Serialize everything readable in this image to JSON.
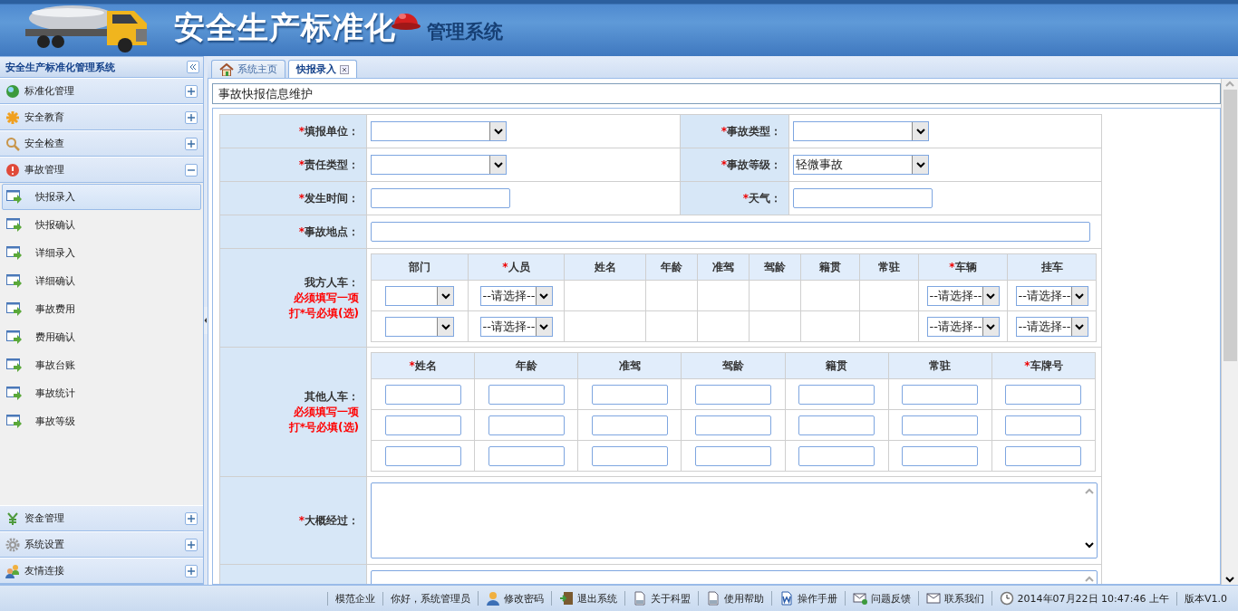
{
  "header": {
    "title": "安全生产标准化",
    "subtitle": "管理系统"
  },
  "sidebar": {
    "title": "安全生产标准化管理系统",
    "sections": [
      {
        "label": "标准化管理",
        "expanded": false
      },
      {
        "label": "安全教育",
        "expanded": false
      },
      {
        "label": "安全检查",
        "expanded": false
      },
      {
        "label": "事故管理",
        "expanded": true,
        "children": [
          {
            "label": "快报录入",
            "selected": true
          },
          {
            "label": "快报确认",
            "selected": false
          },
          {
            "label": "详细录入",
            "selected": false
          },
          {
            "label": "详细确认",
            "selected": false
          },
          {
            "label": "事故费用",
            "selected": false
          },
          {
            "label": "费用确认",
            "selected": false
          },
          {
            "label": "事故台账",
            "selected": false
          },
          {
            "label": "事故统计",
            "selected": false
          },
          {
            "label": "事故等级",
            "selected": false
          }
        ]
      },
      {
        "label": "资金管理",
        "expanded": false
      },
      {
        "label": "系统设置",
        "expanded": false
      },
      {
        "label": "友情连接",
        "expanded": false
      }
    ]
  },
  "tabs": [
    {
      "label": "系统主页",
      "selected": false,
      "closable": false
    },
    {
      "label": "快报录入",
      "selected": true,
      "closable": true
    }
  ],
  "page_title": "事故快报信息维护",
  "form": {
    "rows": [
      [
        {
          "mark": "*",
          "label": "填报单位：",
          "kind": "select"
        },
        {
          "mark": "*",
          "label": "事故类型：",
          "kind": "select"
        }
      ],
      [
        {
          "mark": "*",
          "label": "责任类型：",
          "kind": "select"
        },
        {
          "mark": "*",
          "label": "事故等级：",
          "kind": "select",
          "value": "轻微事故"
        }
      ],
      [
        {
          "mark": "*",
          "label": "发生时间：",
          "kind": "input"
        },
        {
          "mark": "*",
          "label": "天气：",
          "kind": "input"
        }
      ],
      [
        {
          "mark": "*",
          "label": "事故地点：",
          "kind": "wide"
        }
      ]
    ],
    "own_vehicles": {
      "label": "我方人车：",
      "notes": [
        "必须填写一项",
        "打*号必填(选)"
      ],
      "columns": [
        {
          "label": "部门"
        },
        {
          "mark": "*",
          "label": "人员"
        },
        {
          "label": "姓名"
        },
        {
          "label": "年龄"
        },
        {
          "label": "准驾"
        },
        {
          "label": "驾龄"
        },
        {
          "label": "籍贯"
        },
        {
          "label": "常驻"
        },
        {
          "mark": "*",
          "label": "车辆"
        },
        {
          "label": "挂车"
        }
      ],
      "rows": [
        [
          {
            "kind": "select"
          },
          {
            "kind": "select",
            "value": "--请选择--"
          },
          {
            "kind": "blank"
          },
          {
            "kind": "blank"
          },
          {
            "kind": "blank"
          },
          {
            "kind": "blank"
          },
          {
            "kind": "blank"
          },
          {
            "kind": "blank"
          },
          {
            "kind": "select",
            "value": "--请选择--"
          },
          {
            "kind": "select",
            "value": "--请选择--"
          }
        ],
        [
          {
            "kind": "select"
          },
          {
            "kind": "select",
            "value": "--请选择--"
          },
          {
            "kind": "blank"
          },
          {
            "kind": "blank"
          },
          {
            "kind": "blank"
          },
          {
            "kind": "blank"
          },
          {
            "kind": "blank"
          },
          {
            "kind": "blank"
          },
          {
            "kind": "select",
            "value": "--请选择--"
          },
          {
            "kind": "select",
            "value": "--请选择--"
          }
        ]
      ]
    },
    "other_vehicles": {
      "label": "其他人车：",
      "notes": [
        "必须填写一项",
        "打*号必填(选)"
      ],
      "columns": [
        {
          "mark": "*",
          "label": "姓名"
        },
        {
          "label": "年龄"
        },
        {
          "label": "准驾"
        },
        {
          "label": "驾龄"
        },
        {
          "label": "籍贯"
        },
        {
          "label": "常驻"
        },
        {
          "mark": "*",
          "label": "车牌号"
        }
      ],
      "rows": [
        [
          {
            "kind": "input"
          },
          {
            "kind": "input"
          },
          {
            "kind": "input"
          },
          {
            "kind": "input"
          },
          {
            "kind": "input"
          },
          {
            "kind": "input"
          },
          {
            "kind": "input"
          }
        ],
        [
          {
            "kind": "input"
          },
          {
            "kind": "input"
          },
          {
            "kind": "input"
          },
          {
            "kind": "input"
          },
          {
            "kind": "input"
          },
          {
            "kind": "input"
          },
          {
            "kind": "input"
          }
        ],
        [
          {
            "kind": "input"
          },
          {
            "kind": "input"
          },
          {
            "kind": "input"
          },
          {
            "kind": "input"
          },
          {
            "kind": "input"
          },
          {
            "kind": "input"
          },
          {
            "kind": "input"
          }
        ]
      ]
    },
    "description": {
      "mark": "*",
      "label": "大概经过："
    }
  },
  "status_bar": [
    {
      "label": "模范企业"
    },
    {
      "label": "你好，系统管理员"
    },
    {
      "label": "修改密码"
    },
    {
      "label": "退出系统"
    },
    {
      "label": "关于科盟"
    },
    {
      "label": "使用帮助"
    },
    {
      "label": "操作手册"
    },
    {
      "label": "问题反馈"
    },
    {
      "label": "联系我们"
    },
    {
      "label": "2014年07月22日 10:47:46 上午"
    },
    {
      "label": "版本V1.0"
    }
  ]
}
